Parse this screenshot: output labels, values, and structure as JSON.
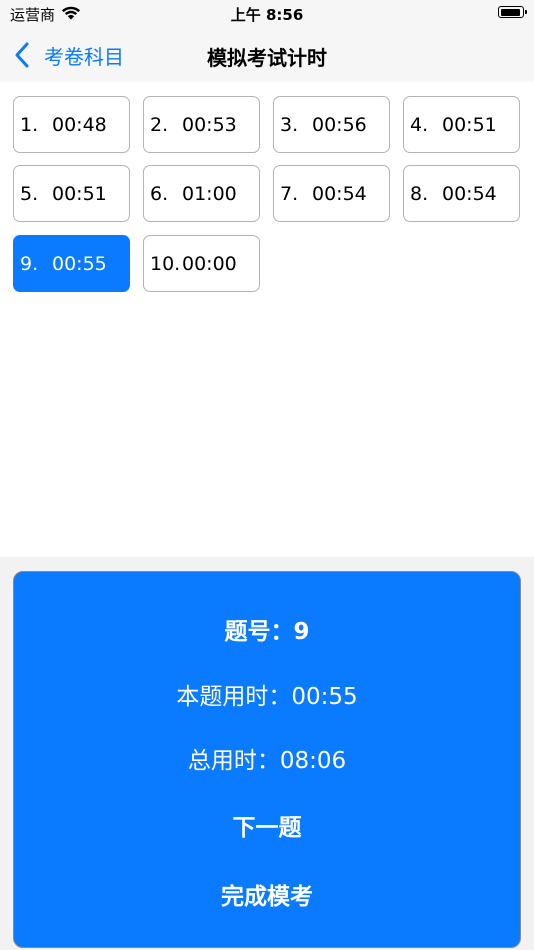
{
  "status_bar": {
    "carrier": "运营商",
    "time": "上午 8:56"
  },
  "nav": {
    "back_label": "考卷科目",
    "title": "模拟考试计时"
  },
  "questions": [
    {
      "num": "1.",
      "time": "00:48",
      "selected": false
    },
    {
      "num": "2.",
      "time": "00:53",
      "selected": false
    },
    {
      "num": "3.",
      "time": "00:56",
      "selected": false
    },
    {
      "num": "4.",
      "time": "00:51",
      "selected": false
    },
    {
      "num": "5.",
      "time": "00:51",
      "selected": false
    },
    {
      "num": "6.",
      "time": "01:00",
      "selected": false
    },
    {
      "num": "7.",
      "time": "00:54",
      "selected": false
    },
    {
      "num": "8.",
      "time": "00:54",
      "selected": false
    },
    {
      "num": "9.",
      "time": "00:55",
      "selected": true
    },
    {
      "num": "10.",
      "time": "00:00",
      "selected": false
    }
  ],
  "panel": {
    "question_label": "题号：",
    "question_value": "9",
    "current_label": "本题用时：",
    "current_value": "00:55",
    "total_label": "总用时：",
    "total_value": "08:06",
    "next_label": "下一题",
    "finish_label": "完成模考"
  },
  "colors": {
    "accent": "#0a7aff"
  }
}
